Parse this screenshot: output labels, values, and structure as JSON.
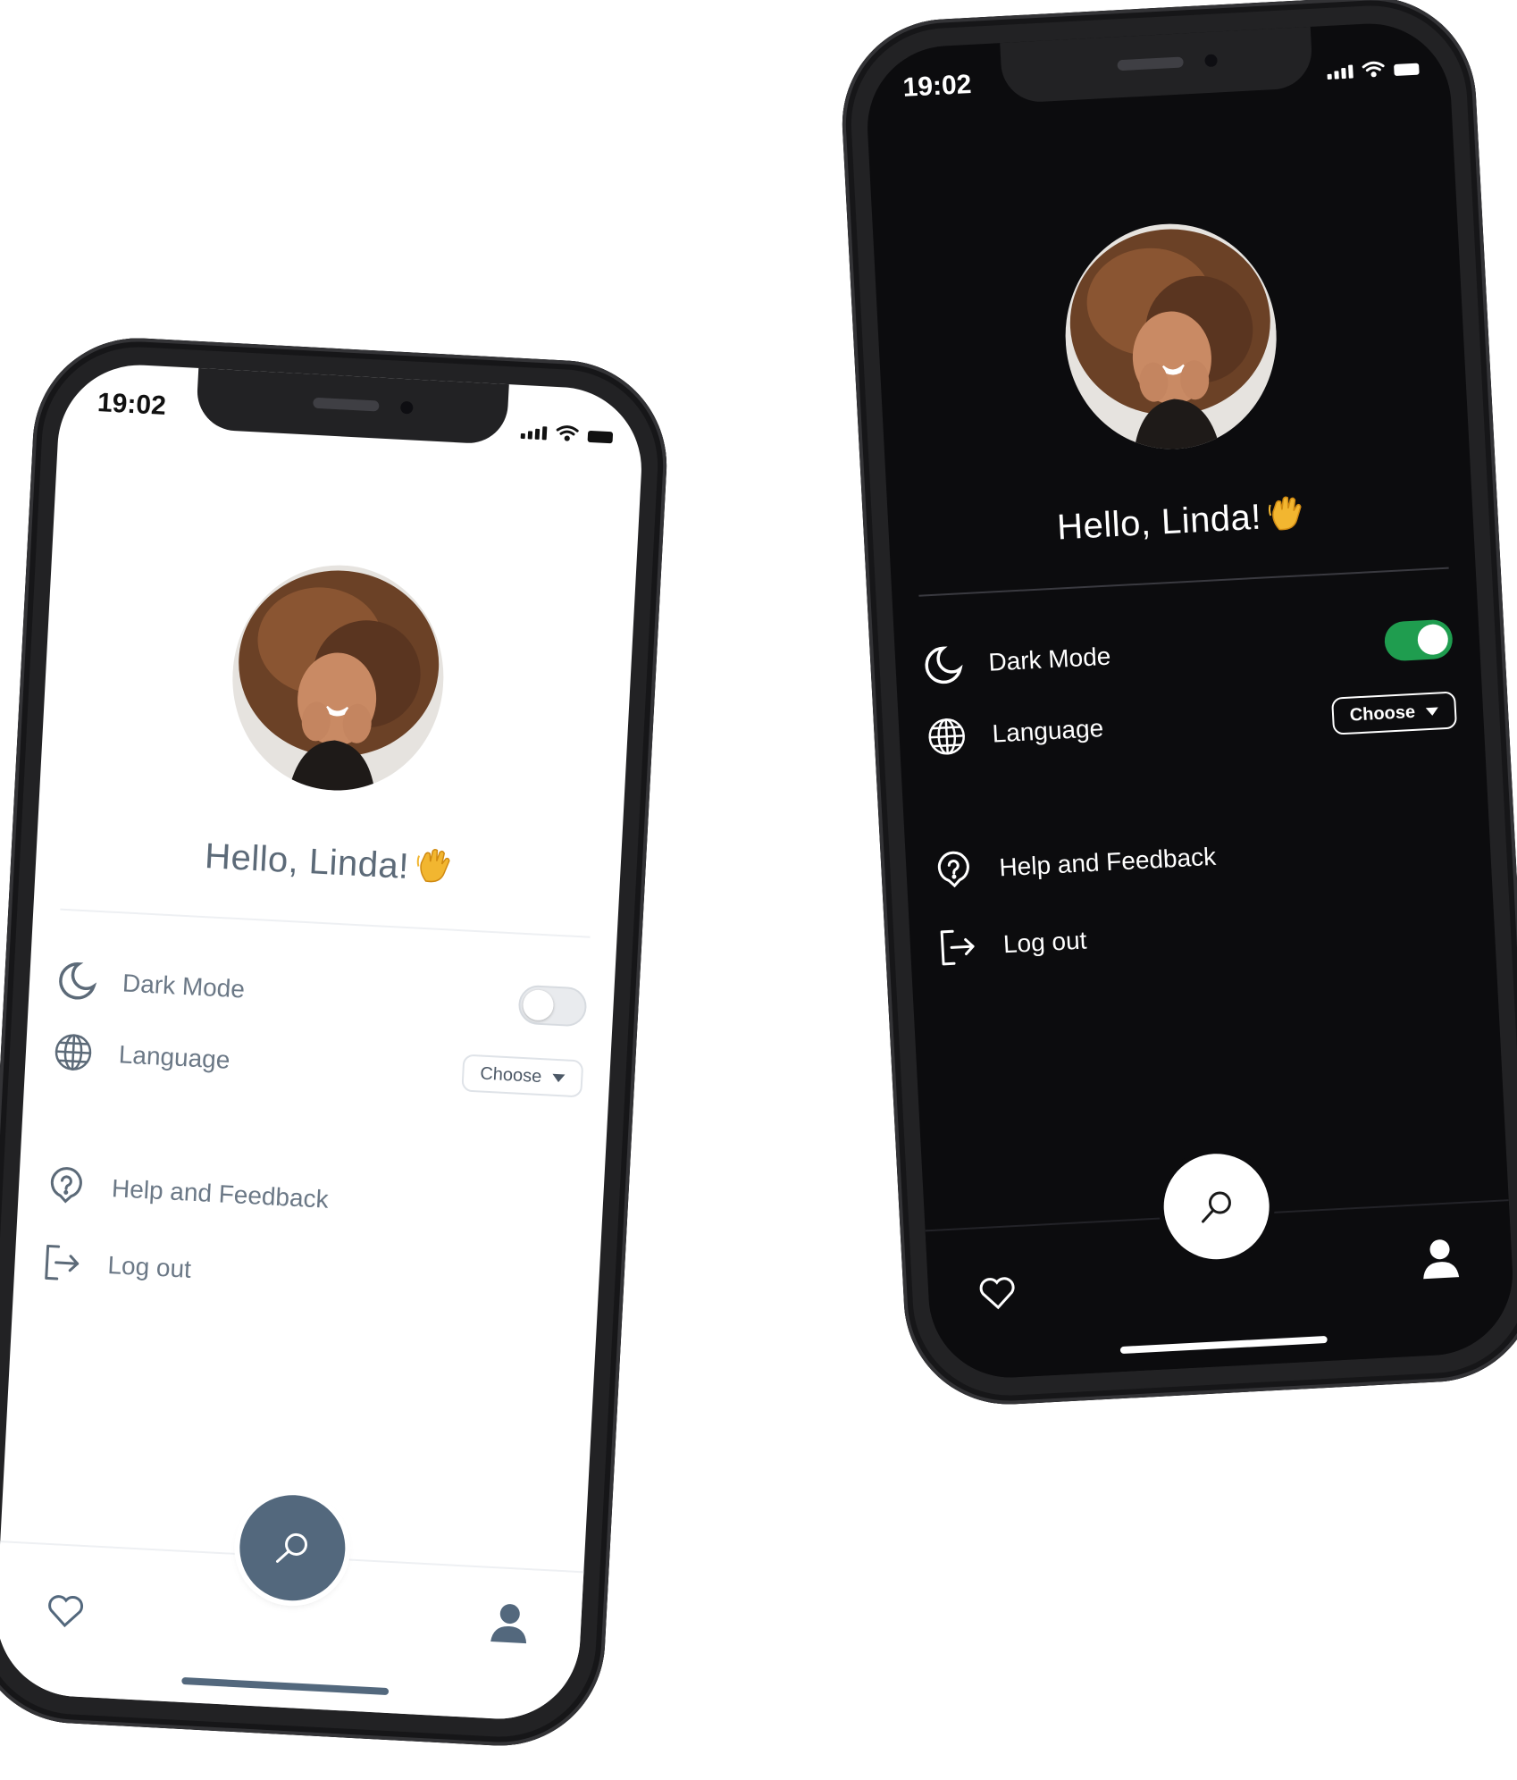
{
  "phones": {
    "light": {
      "theme": "light",
      "status_bar": {
        "time": "19:02"
      },
      "profile": {
        "greeting": "Hello, Linda!",
        "greeting_emoji": "waving-hand-icon"
      },
      "settings": {
        "dark_mode": {
          "label": "Dark Mode",
          "icon": "moon-icon",
          "enabled": false
        },
        "language": {
          "label": "Language",
          "icon": "globe-icon",
          "dropdown_label": "Choose"
        },
        "help": {
          "label": "Help and Feedback",
          "icon": "help-icon"
        },
        "logout": {
          "label": "Log out",
          "icon": "logout-icon"
        }
      },
      "nav": {
        "left": "heart-icon",
        "center": "search-icon",
        "right": "user-icon"
      },
      "colors": {
        "background": "#ffffff",
        "text": "#6b7886",
        "accent": "#53687d"
      }
    },
    "dark": {
      "theme": "dark",
      "status_bar": {
        "time": "19:02"
      },
      "profile": {
        "greeting": "Hello, Linda!",
        "greeting_emoji": "waving-hand-icon"
      },
      "settings": {
        "dark_mode": {
          "label": "Dark Mode",
          "icon": "moon-icon",
          "enabled": true
        },
        "language": {
          "label": "Language",
          "icon": "globe-icon",
          "dropdown_label": "Choose"
        },
        "help": {
          "label": "Help and Feedback",
          "icon": "help-icon"
        },
        "logout": {
          "label": "Log out",
          "icon": "logout-icon"
        }
      },
      "nav": {
        "left": "heart-icon",
        "center": "search-icon",
        "right": "user-icon"
      },
      "colors": {
        "background": "#0c0c0e",
        "text": "#ffffff",
        "toggle_on": "#1f9d4f"
      }
    }
  }
}
